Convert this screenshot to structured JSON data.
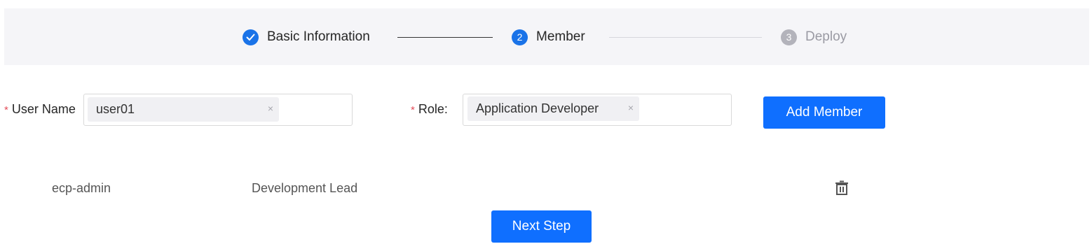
{
  "steps": [
    {
      "label": "Basic Information",
      "status": "done",
      "icon": "check-icon"
    },
    {
      "label": "Member",
      "number": "2",
      "status": "active"
    },
    {
      "label": "Deploy",
      "number": "3",
      "status": "waiting"
    }
  ],
  "form": {
    "username_label": "User Name",
    "username_tag": "user01",
    "role_label": "Role:",
    "role_tag": "Application Developer",
    "required_mark": "*",
    "tag_close": "×",
    "add_member_label": "Add Member"
  },
  "members": [
    {
      "username": "ecp-admin",
      "role": "Development Lead",
      "action_icon": "trash-icon"
    }
  ],
  "footer": {
    "next_step_label": "Next Step"
  },
  "colors": {
    "primary": "#0f6fff",
    "required": "#e34d59",
    "steps_background": "#f5f5f8"
  }
}
